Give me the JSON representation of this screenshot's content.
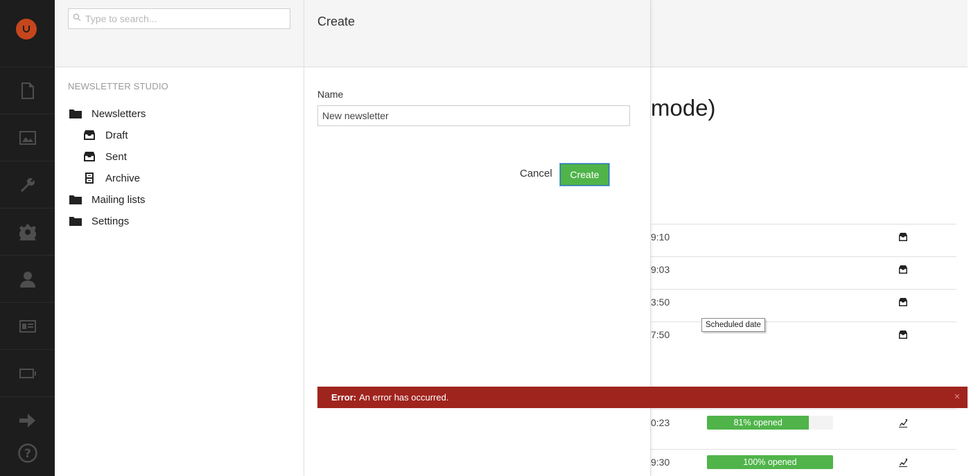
{
  "search": {
    "placeholder": "Type to search..."
  },
  "tree": {
    "section_title": "NEWSLETTER STUDIO",
    "items": [
      {
        "label": "Newsletters",
        "icon": "folder-icon"
      },
      {
        "label": "Draft",
        "icon": "inbox-upload-icon"
      },
      {
        "label": "Sent",
        "icon": "inbox-icon"
      },
      {
        "label": "Archive",
        "icon": "archive-icon"
      },
      {
        "label": "Mailing lists",
        "icon": "folder-icon"
      },
      {
        "label": "Settings",
        "icon": "folder-icon"
      }
    ]
  },
  "dialog": {
    "title": "Create",
    "name_label": "Name",
    "name_value": "New newsletter",
    "cancel_label": "Cancel",
    "create_label": "Create"
  },
  "background": {
    "title_fragment": "mode)",
    "times": [
      "9:10",
      "9:03",
      "3:50",
      "7:50",
      "0:23",
      "9:30"
    ],
    "tooltip": "Scheduled date",
    "progress": [
      {
        "label": "81% opened",
        "value": 0.81
      },
      {
        "label": "100% opened",
        "value": 1.0
      }
    ]
  },
  "error": {
    "prefix": "Error:",
    "message": "An error has occurred.",
    "close": "×"
  },
  "colors": {
    "rail": "#1d1d1d",
    "logo": "#c6461c",
    "success": "#50b44a",
    "error": "#a0241e"
  }
}
